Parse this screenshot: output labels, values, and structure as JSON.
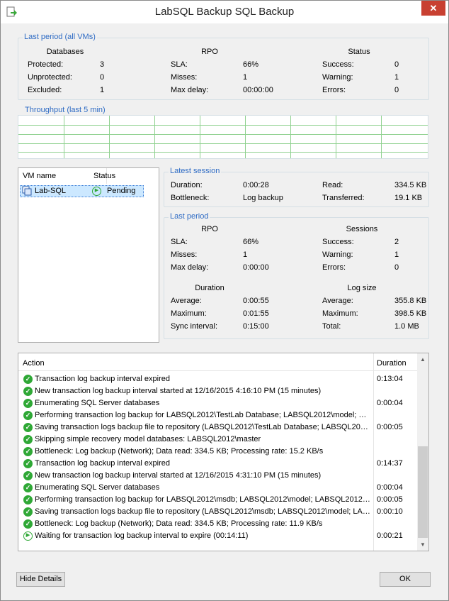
{
  "window": {
    "title": "LabSQL Backup SQL Backup",
    "close_glyph": "✕"
  },
  "last_period_all": {
    "title": "Last period (all VMs)",
    "databases": {
      "header": "Databases",
      "rows": [
        {
          "label": "Protected:",
          "value": "3"
        },
        {
          "label": "Unprotected:",
          "value": "0"
        },
        {
          "label": "Excluded:",
          "value": "1"
        }
      ]
    },
    "rpo": {
      "header": "RPO",
      "rows": [
        {
          "label": "SLA:",
          "value": "66%"
        },
        {
          "label": "Misses:",
          "value": "1"
        },
        {
          "label": "Max delay:",
          "value": "00:00:00"
        }
      ]
    },
    "status": {
      "header": "Status",
      "rows": [
        {
          "label": "Success:",
          "value": "0"
        },
        {
          "label": "Warning:",
          "value": "1"
        },
        {
          "label": "Errors:",
          "value": "0"
        }
      ]
    }
  },
  "throughput": {
    "title": "Throughput (last 5 min)"
  },
  "vm_list": {
    "col_name": "VM name",
    "col_status": "Status",
    "rows": [
      {
        "name": "Lab-SQL",
        "status": "Pending"
      }
    ]
  },
  "latest_session": {
    "title": "Latest session",
    "duration_label": "Duration:",
    "duration": "0:00:28",
    "bottleneck_label": "Bottleneck:",
    "bottleneck": "Log backup",
    "read_label": "Read:",
    "read": "334.5 KB",
    "transferred_label": "Transferred:",
    "transferred": "19.1 KB"
  },
  "last_period": {
    "title": "Last period",
    "rpo": {
      "header": "RPO",
      "rows": [
        {
          "label": "SLA:",
          "value": "66%"
        },
        {
          "label": "Misses:",
          "value": "1"
        },
        {
          "label": "Max delay:",
          "value": "0:00:00"
        }
      ]
    },
    "sessions": {
      "header": "Sessions",
      "rows": [
        {
          "label": "Success:",
          "value": "2"
        },
        {
          "label": "Warning:",
          "value": "1"
        },
        {
          "label": "Errors:",
          "value": "0"
        }
      ]
    },
    "duration": {
      "header": "Duration",
      "rows": [
        {
          "label": "Average:",
          "value": "0:00:55"
        },
        {
          "label": "Maximum:",
          "value": "0:01:55"
        },
        {
          "label": "Sync interval:",
          "value": "0:15:00"
        }
      ]
    },
    "log_size": {
      "header": "Log size",
      "rows": [
        {
          "label": "Average:",
          "value": "355.8 KB"
        },
        {
          "label": "Maximum:",
          "value": "398.5 KB"
        },
        {
          "label": "Total:",
          "value": "1.0 MB"
        }
      ]
    }
  },
  "log": {
    "col_action": "Action",
    "col_duration": "Duration",
    "rows": [
      {
        "icon": "success-icon",
        "text": "Transaction log backup interval expired",
        "duration": "0:13:04"
      },
      {
        "icon": "success-icon",
        "text": "New transaction log backup interval started at 12/16/2015 4:16:10 PM (15 minutes)",
        "duration": ""
      },
      {
        "icon": "success-icon",
        "text": "Enumerating SQL Server databases",
        "duration": "0:00:04"
      },
      {
        "icon": "success-icon",
        "text": "Performing transaction log backup for LABSQL2012\\TestLab Database; LABSQL2012\\model; LA...",
        "duration": ""
      },
      {
        "icon": "success-icon",
        "text": "Saving transaction logs backup file to repository (LABSQL2012\\TestLab Database; LABSQL2012...",
        "duration": "0:00:05"
      },
      {
        "icon": "success-icon",
        "text": "Skipping simple recovery model databases: LABSQL2012\\master",
        "duration": ""
      },
      {
        "icon": "success-icon",
        "text": "Bottleneck: Log backup (Network); Data read: 334.5 KB; Processing rate: 15.2 KB/s",
        "duration": ""
      },
      {
        "icon": "success-icon",
        "text": "Transaction log backup interval expired",
        "duration": "0:14:37"
      },
      {
        "icon": "success-icon",
        "text": "New transaction log backup interval started at 12/16/2015 4:31:10 PM (15 minutes)",
        "duration": ""
      },
      {
        "icon": "success-icon",
        "text": "Enumerating SQL Server databases",
        "duration": "0:00:04"
      },
      {
        "icon": "success-icon",
        "text": "Performing transaction log backup for LABSQL2012\\msdb; LABSQL2012\\model; LABSQL2012\\T...",
        "duration": "0:00:05"
      },
      {
        "icon": "success-icon",
        "text": "Saving transaction logs backup file to repository (LABSQL2012\\msdb; LABSQL2012\\model; LABS...",
        "duration": "0:00:10"
      },
      {
        "icon": "success-icon",
        "text": "Bottleneck: Log backup (Network); Data read: 334.5 KB; Processing rate: 11.9 KB/s",
        "duration": ""
      },
      {
        "icon": "pending-icon",
        "text": "Waiting for transaction log backup interval to expire (00:14:11)",
        "duration": "0:00:21"
      }
    ]
  },
  "buttons": {
    "hide_details": "Hide Details",
    "ok": "OK"
  },
  "colors": {
    "accent": "#2e6bc4",
    "success": "#2fa836",
    "close": "#c84031",
    "grid": "#8fd18f"
  }
}
